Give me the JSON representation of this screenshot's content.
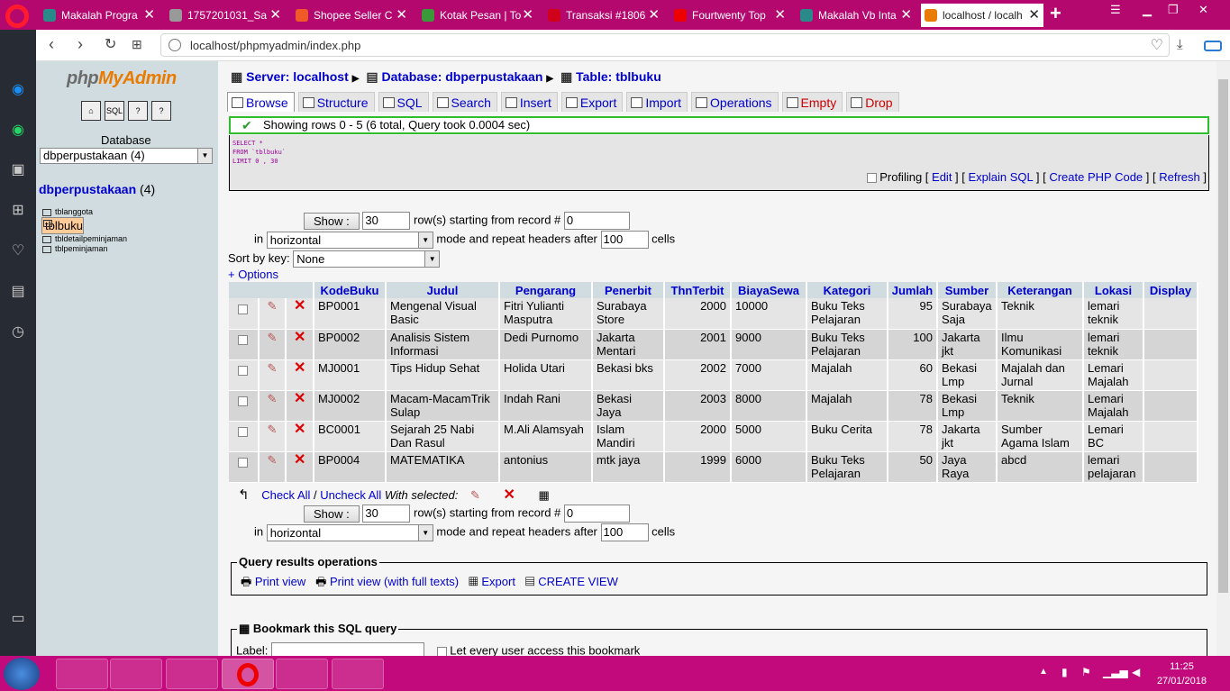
{
  "browser": {
    "tabs": [
      {
        "label": "Makalah Progra",
        "fav": "#2a8a8a"
      },
      {
        "label": "1757201031_Sa",
        "fav": "#999"
      },
      {
        "label": "Shopee Seller C",
        "fav": "#f05a28"
      },
      {
        "label": "Kotak Pesan | To",
        "fav": "#3a9a3a"
      },
      {
        "label": "Transaksi #1806",
        "fav": "#d0021b"
      },
      {
        "label": "Fourtwenty Top",
        "fav": "#e00"
      },
      {
        "label": "Makalah Vb Inta",
        "fav": "#2a8a8a"
      },
      {
        "label": "localhost / localh",
        "fav": "#e97b00"
      }
    ],
    "url": "localhost/phpmyadmin/index.php"
  },
  "left": {
    "logo_php": "php",
    "logo_admin": "MyAdmin",
    "database_label": "Database",
    "db_select": "dbperpustakaan (4)",
    "db_title": "dbperpustakaan",
    "db_count": "(4)",
    "tables": [
      "tblanggota",
      "tblbuku",
      "tbldetailpeminjaman",
      "tblpeminjaman"
    ]
  },
  "breadcrumb": {
    "server": "Server: localhost",
    "database": "Database: dbperpustakaan",
    "table": "Table: tblbuku"
  },
  "tabs": [
    "Browse",
    "Structure",
    "SQL",
    "Search",
    "Insert",
    "Export",
    "Import",
    "Operations",
    "Empty",
    "Drop"
  ],
  "message": "Showing rows 0 - 5 (6 total, Query took 0.0004 sec)",
  "sql": {
    "line1": "SELECT *",
    "line2": "FROM `tblbuku`",
    "line3": "LIMIT 0 , 30",
    "profiling": "Profiling",
    "edit": "Edit",
    "explain": "Explain SQL",
    "php": "Create PHP Code",
    "refresh": "Refresh"
  },
  "nav": {
    "show_button": "Show :",
    "rows_value": "30",
    "rows_text": "row(s) starting from record #",
    "start_value": "0",
    "in_text": "in",
    "mode_value": "horizontal",
    "mode_text": "mode and repeat headers after",
    "repeat_value": "100",
    "cells_text": "cells",
    "sort_label": "Sort by key:",
    "sort_value": "None",
    "options": "+ Options"
  },
  "table": {
    "headers": [
      "KodeBuku",
      "Judul",
      "Pengarang",
      "Penerbit",
      "ThnTerbit",
      "BiayaSewa",
      "Kategori",
      "Jumlah",
      "Sumber",
      "Keterangan",
      "Lokasi",
      "Display"
    ],
    "rows": [
      [
        "BP0001",
        "Mengenal Visual Basic",
        "Fitri Yulianti Masputra",
        "Surabaya Store",
        "2000",
        "10000",
        "Buku Teks Pelajaran",
        "95",
        "Surabaya Saja",
        "Teknik",
        "lemari teknik",
        ""
      ],
      [
        "BP0002",
        "Analisis Sistem Informasi",
        "Dedi Purnomo",
        "Jakarta Mentari",
        "2001",
        "9000",
        "Buku Teks Pelajaran",
        "100",
        "Jakarta jkt",
        "Ilmu Komunikasi",
        "lemari teknik",
        ""
      ],
      [
        "MJ0001",
        "Tips Hidup Sehat",
        "Holida Utari",
        "Bekasi bks",
        "2002",
        "7000",
        "Majalah",
        "60",
        "Bekasi Lmp",
        "Majalah dan Jurnal",
        "Lemari Majalah",
        ""
      ],
      [
        "MJ0002",
        "Macam-MacamTrik Sulap",
        "Indah Rani",
        "Bekasi Jaya",
        "2003",
        "8000",
        "Majalah",
        "78",
        "Bekasi Lmp",
        "Teknik",
        "Lemari Majalah",
        ""
      ],
      [
        "BC0001",
        "Sejarah 25 Nabi Dan Rasul",
        "M.Ali Alamsyah",
        "Islam Mandiri",
        "2000",
        "5000",
        "Buku Cerita",
        "78",
        "Jakarta jkt",
        "Sumber Agama Islam",
        "Lemari BC",
        ""
      ],
      [
        "BP0004",
        "MATEMATIKA",
        "antonius",
        "mtk jaya",
        "1999",
        "6000",
        "Buku Teks Pelajaran",
        "50",
        "Jaya Raya",
        "abcd",
        "lemari pelajaran",
        ""
      ]
    ]
  },
  "bulk": {
    "check_all": "Check All",
    "slash": "/",
    "uncheck_all": "Uncheck All",
    "with_selected": "With selected:"
  },
  "qro": {
    "legend": "Query results operations",
    "print": "Print view",
    "print_full": "Print view (with full texts)",
    "export": "Export",
    "create_view": "CREATE VIEW"
  },
  "bookmark": {
    "legend": "Bookmark this SQL query",
    "label": "Label:",
    "every_user": "Let every user access this bookmark"
  },
  "taskbar": {
    "time": "11:25",
    "date": "27/01/2018"
  }
}
